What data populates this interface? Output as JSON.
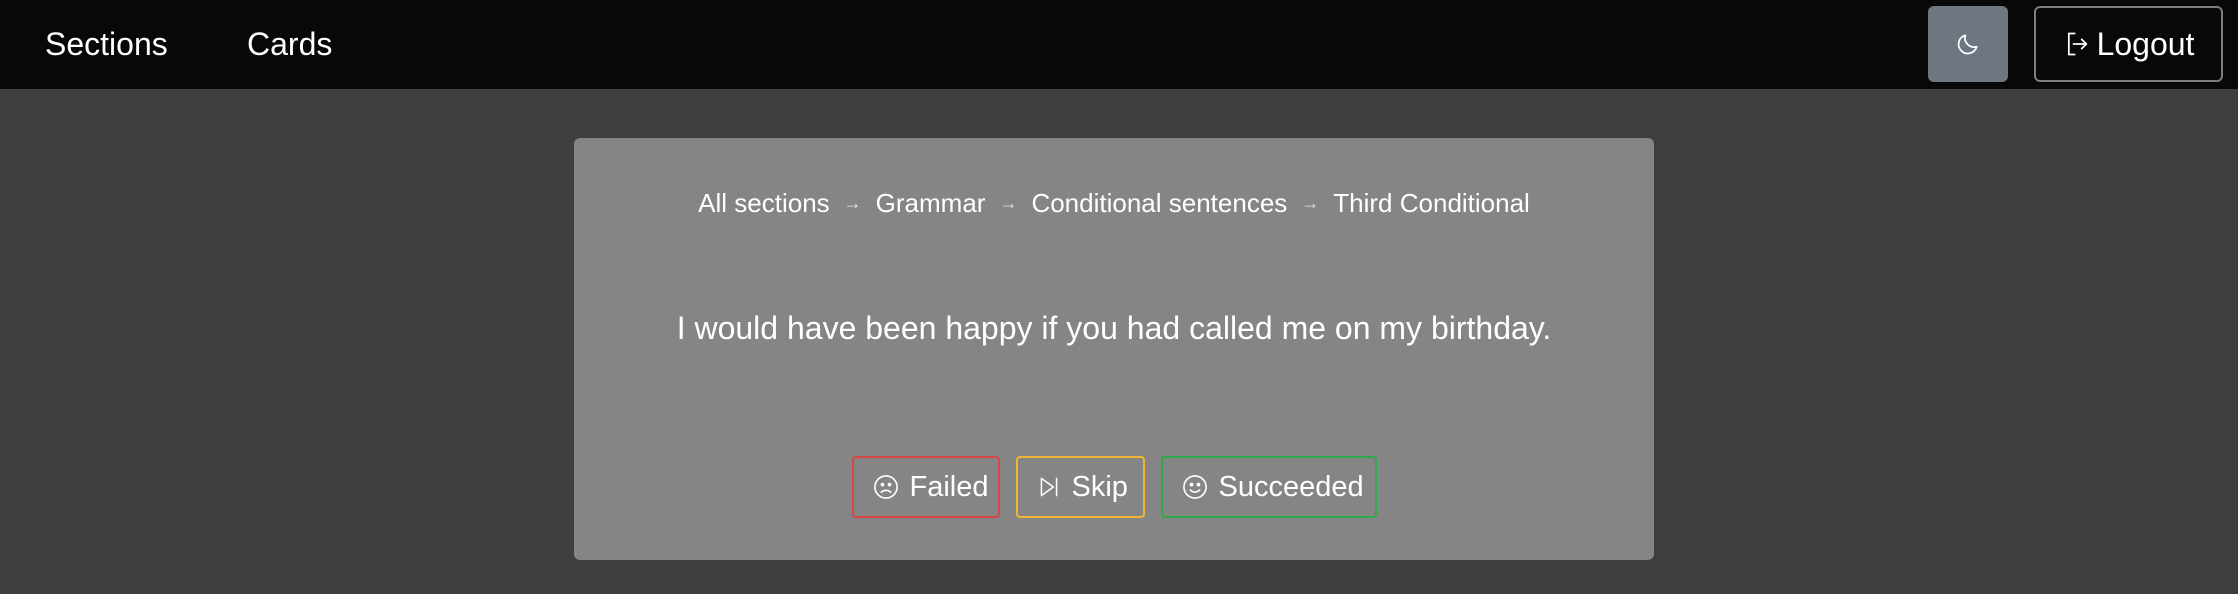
{
  "nav": {
    "links": [
      {
        "label": "Sections"
      },
      {
        "label": "Cards"
      }
    ],
    "theme_toggle_icon": "moon-icon",
    "logout_label": "Logout",
    "logout_icon": "logout-icon"
  },
  "card": {
    "breadcrumb": [
      "All sections",
      "Grammar",
      "Conditional sentences",
      "Third Conditional"
    ],
    "separator": "→",
    "sentence": "I would have been happy if you had called me on my birthday.",
    "actions": [
      {
        "label": "Failed",
        "icon": "frown-icon",
        "color": "#d94444"
      },
      {
        "label": "Skip",
        "icon": "skip-forward-icon",
        "color": "#f1b535"
      },
      {
        "label": "Succeeded",
        "icon": "smile-icon",
        "color": "#2fa84a"
      }
    ]
  },
  "colors": {
    "background": "#3e3e3e",
    "navbar": "#080808",
    "card": "#858585",
    "theme_toggle": "#6d7681"
  }
}
